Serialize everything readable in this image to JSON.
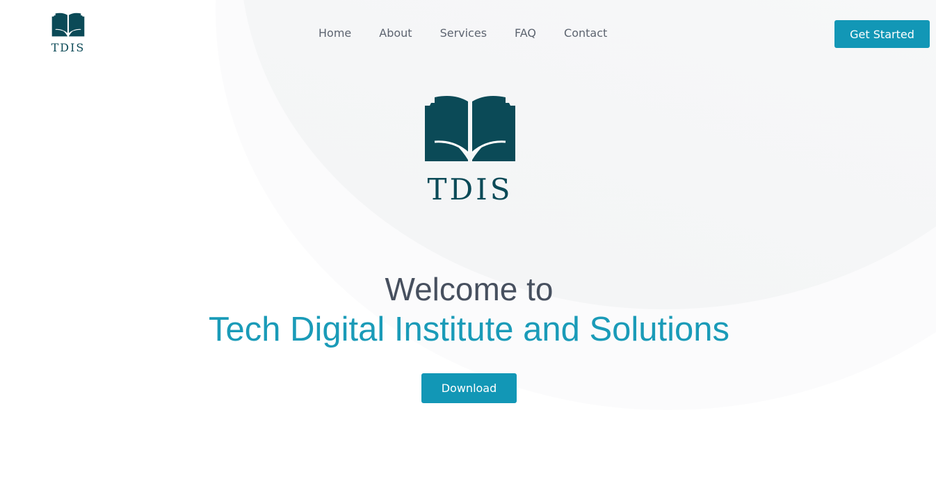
{
  "brand": {
    "name": "TDIS",
    "color": "#0b4a57"
  },
  "nav": {
    "items": [
      {
        "label": "Home"
      },
      {
        "label": "About"
      },
      {
        "label": "Services"
      },
      {
        "label": "FAQ"
      },
      {
        "label": "Contact"
      }
    ]
  },
  "header": {
    "cta_label": "Get Started"
  },
  "hero": {
    "title": "Welcome to",
    "subtitle": "Tech Digital Institute and Solutions",
    "button_label": "Download"
  },
  "colors": {
    "accent": "#1297b6",
    "text": "#47505f",
    "nav_text": "#5d6470"
  },
  "icons": {
    "logo": "open-book-icon"
  }
}
